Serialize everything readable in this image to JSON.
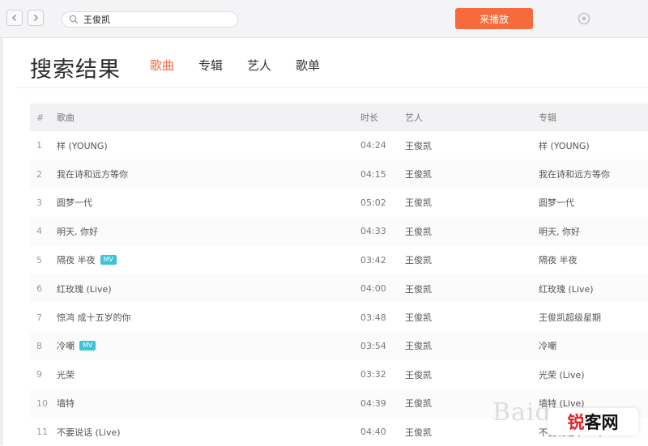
{
  "search": {
    "value": "王俊凯"
  },
  "toolbar": {
    "open_button_label": "来播放"
  },
  "page": {
    "title": "搜索结果",
    "tabs": [
      {
        "label": "歌曲",
        "active": true
      },
      {
        "label": "专辑",
        "active": false
      },
      {
        "label": "艺人",
        "active": false
      },
      {
        "label": "歌单",
        "active": false
      }
    ]
  },
  "table": {
    "headers": {
      "index": "#",
      "song": "歌曲",
      "duration": "时长",
      "artist": "艺人",
      "album": "专辑"
    },
    "rows": [
      {
        "index": "1",
        "song": "样 (YOUNG)",
        "tag": "",
        "duration": "04:24",
        "artist": "王俊凯",
        "album": "样 (YOUNG)"
      },
      {
        "index": "2",
        "song": "我在诗和远方等你",
        "tag": "",
        "duration": "04:15",
        "artist": "王俊凯",
        "album": "我在诗和远方等你"
      },
      {
        "index": "3",
        "song": "圆梦一代",
        "tag": "",
        "duration": "05:02",
        "artist": "王俊凯",
        "album": "圆梦一代"
      },
      {
        "index": "4",
        "song": "明天, 你好",
        "tag": "",
        "duration": "04:33",
        "artist": "王俊凯",
        "album": "明天, 你好"
      },
      {
        "index": "5",
        "song": "隔夜 半夜",
        "tag": "MV",
        "duration": "03:42",
        "artist": "王俊凯",
        "album": "隔夜 半夜"
      },
      {
        "index": "6",
        "song": "红玫瑰 (Live)",
        "tag": "",
        "duration": "04:00",
        "artist": "王俊凯",
        "album": "红玫瑰 (Live)"
      },
      {
        "index": "7",
        "song": "惊鸿 成十五岁的你",
        "tag": "",
        "duration": "03:48",
        "artist": "王俊凯",
        "album": "王俊凯超级星期"
      },
      {
        "index": "8",
        "song": "冷嘲",
        "tag": "MV",
        "duration": "03:54",
        "artist": "王俊凯",
        "album": "冷嘲"
      },
      {
        "index": "9",
        "song": "光荣",
        "tag": "",
        "duration": "03:32",
        "artist": "王俊凯",
        "album": "光荣 (Live)"
      },
      {
        "index": "10",
        "song": "墙特",
        "tag": "",
        "duration": "04:39",
        "artist": "王俊凯",
        "album": "墙特 (Live)"
      },
      {
        "index": "11",
        "song": "不要说话 (Live)",
        "tag": "",
        "duration": "04:40",
        "artist": "王俊凯",
        "album": "不要说话 (Live)"
      }
    ]
  },
  "watermark": {
    "baidu_text": "Baidu",
    "brand_prefix": "锐",
    "brand_suffix": "客网"
  },
  "colors": {
    "accent": "#f46b42",
    "button_bg": "#f66a3c",
    "tag_bg": "#3cc3d6"
  },
  "icons": {
    "back": "chevron-left-icon",
    "forward": "chevron-right-icon",
    "search": "search-icon",
    "settings": "gear-icon"
  }
}
